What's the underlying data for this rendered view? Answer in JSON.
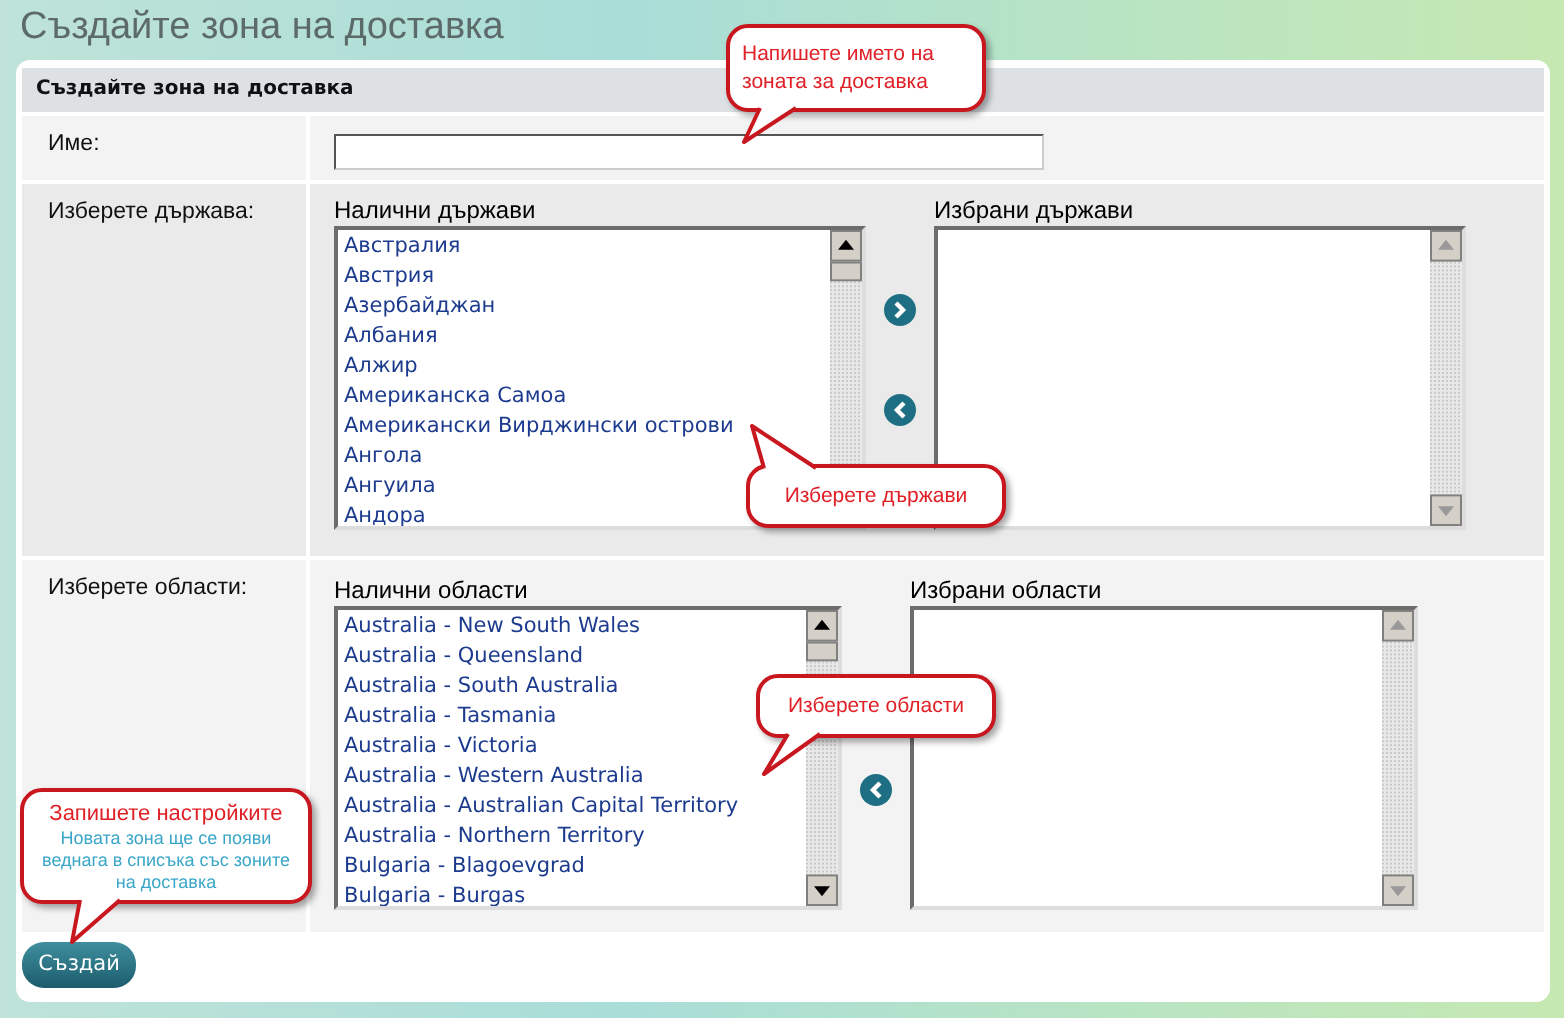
{
  "page_title": "Създайте зона на доставка",
  "panel_title": "Създайте зона на доставка",
  "name_field": {
    "label": "Име:"
  },
  "countries": {
    "label": "Изберете държава:",
    "available_title": "Налични държави",
    "selected_title": "Избрани държави",
    "available": [
      "Австралия",
      "Австрия",
      "Азербайджан",
      "Албания",
      "Алжир",
      "Американска Самоа",
      "Американски Вирджински острови",
      "Ангола",
      "Ангуила",
      "Андора"
    ],
    "add_arrow": true
  },
  "regions": {
    "label": "Изберете области:",
    "available_title": "Налични области",
    "selected_title": "Избрани области",
    "available": [
      "Australia - New South Wales",
      "Australia - Queensland",
      "Australia - South Australia",
      "Australia - Tasmania",
      "Australia - Victoria",
      "Australia - Western Australia",
      "Australia - Australian Capital Territory",
      "Australia - Northern Territory",
      "Bulgaria - Blagoevgrad",
      "Bulgaria - Burgas"
    ],
    "add_arrow": false
  },
  "submit_button": "Създай",
  "callouts": [
    {
      "kind": "name",
      "title": "Напишете името на зоната за доставка"
    },
    {
      "kind": "countries",
      "title": "Изберете държави"
    },
    {
      "kind": "regions",
      "title": "Изберете области"
    },
    {
      "kind": "save",
      "title": "Запишете настройките",
      "note": "Новата зона ще се появи веднага в списъка със зоните на доставка"
    }
  ]
}
